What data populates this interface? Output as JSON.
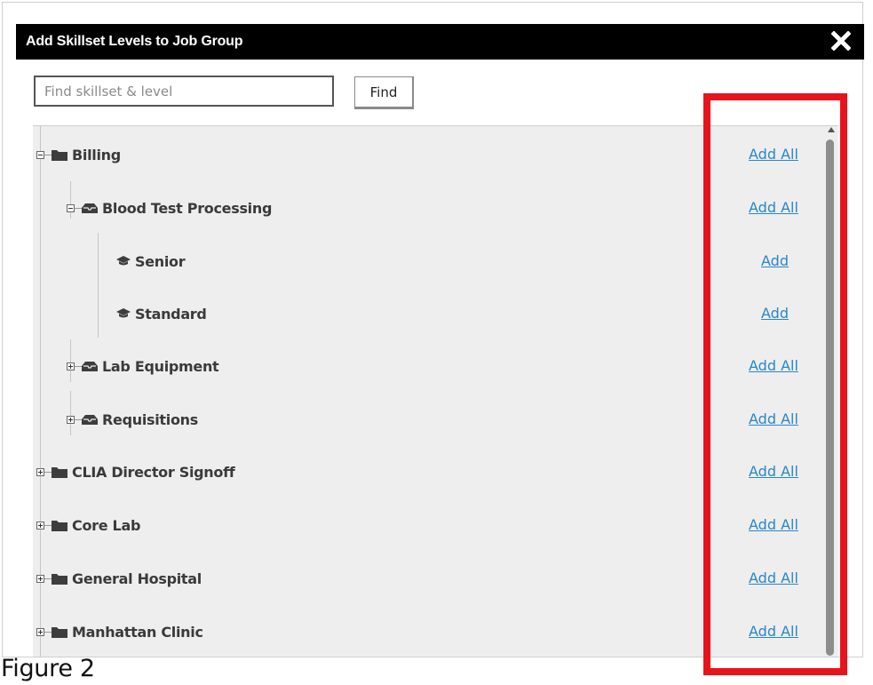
{
  "dialog": {
    "title": "Add Skillset Levels to Job Group",
    "close_icon": "close-x-icon"
  },
  "search": {
    "placeholder": "Find skillset & level",
    "value": "",
    "button_label": "Find"
  },
  "tree": {
    "billing": {
      "label": "Billing",
      "action": "Add All",
      "icon": "folder-icon",
      "state": "expanded"
    },
    "blood_test": {
      "label": "Blood Test Processing",
      "action": "Add All",
      "icon": "tray-icon",
      "state": "expanded"
    },
    "senior": {
      "label": "Senior",
      "action": "Add",
      "icon": "graduation-cap-icon"
    },
    "standard": {
      "label": "Standard",
      "action": "Add",
      "icon": "graduation-cap-icon"
    },
    "lab_equipment": {
      "label": "Lab Equipment",
      "action": "Add All",
      "icon": "tray-icon",
      "state": "collapsed"
    },
    "requisitions": {
      "label": "Requisitions",
      "action": "Add All",
      "icon": "tray-icon",
      "state": "collapsed"
    },
    "clia": {
      "label": "CLIA Director Signoff",
      "action": "Add All",
      "icon": "folder-icon",
      "state": "collapsed"
    },
    "core_lab": {
      "label": "Core Lab",
      "action": "Add All",
      "icon": "folder-icon",
      "state": "collapsed"
    },
    "general_hospital": {
      "label": "General Hospital",
      "action": "Add All",
      "icon": "folder-icon",
      "state": "collapsed"
    },
    "manhattan": {
      "label": "Manhattan Clinic",
      "action": "Add All",
      "icon": "folder-icon",
      "state": "collapsed"
    }
  },
  "caption": "Figure 2",
  "colors": {
    "title_bar": "#000000",
    "panel_bg": "#eeeeee",
    "link": "#2a86c9",
    "highlight": "#e8141c"
  }
}
